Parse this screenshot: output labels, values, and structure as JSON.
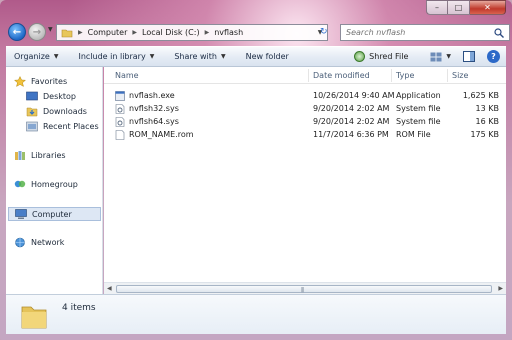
{
  "address": {
    "crumbs": [
      "Computer",
      "Local Disk (C:)",
      "nvflash"
    ]
  },
  "search": {
    "placeholder": "Search nvflash"
  },
  "toolbar": {
    "organize": "Organize",
    "include_in_library": "Include in library",
    "share_with": "Share with",
    "new_folder": "New folder",
    "shred_file": "Shred File"
  },
  "sidebar": {
    "favorites": "Favorites",
    "desktop": "Desktop",
    "downloads": "Downloads",
    "recent_places": "Recent Places",
    "libraries": "Libraries",
    "homegroup": "Homegroup",
    "computer": "Computer",
    "network": "Network"
  },
  "columns": {
    "name": "Name",
    "date_modified": "Date modified",
    "type": "Type",
    "size": "Size"
  },
  "files": [
    {
      "name": "nvflash.exe",
      "date": "10/26/2014 9:40 AM",
      "type": "Application",
      "size": "1,625 KB",
      "icon": "application-icon"
    },
    {
      "name": "nvflsh32.sys",
      "date": "9/20/2014 2:02 AM",
      "type": "System file",
      "size": "13 KB",
      "icon": "system-file-icon"
    },
    {
      "name": "nvflsh64.sys",
      "date": "9/20/2014 2:02 AM",
      "type": "System file",
      "size": "16 KB",
      "icon": "system-file-icon"
    },
    {
      "name": "ROM_NAME.rom",
      "date": "11/7/2014 6:36 PM",
      "type": "ROM File",
      "size": "175 KB",
      "icon": "generic-file-icon"
    }
  ],
  "details": {
    "count": "4 items"
  },
  "colors": {
    "selection": "#dde7f4",
    "header_text": "#4c607a",
    "accent": "#2c69c8"
  }
}
